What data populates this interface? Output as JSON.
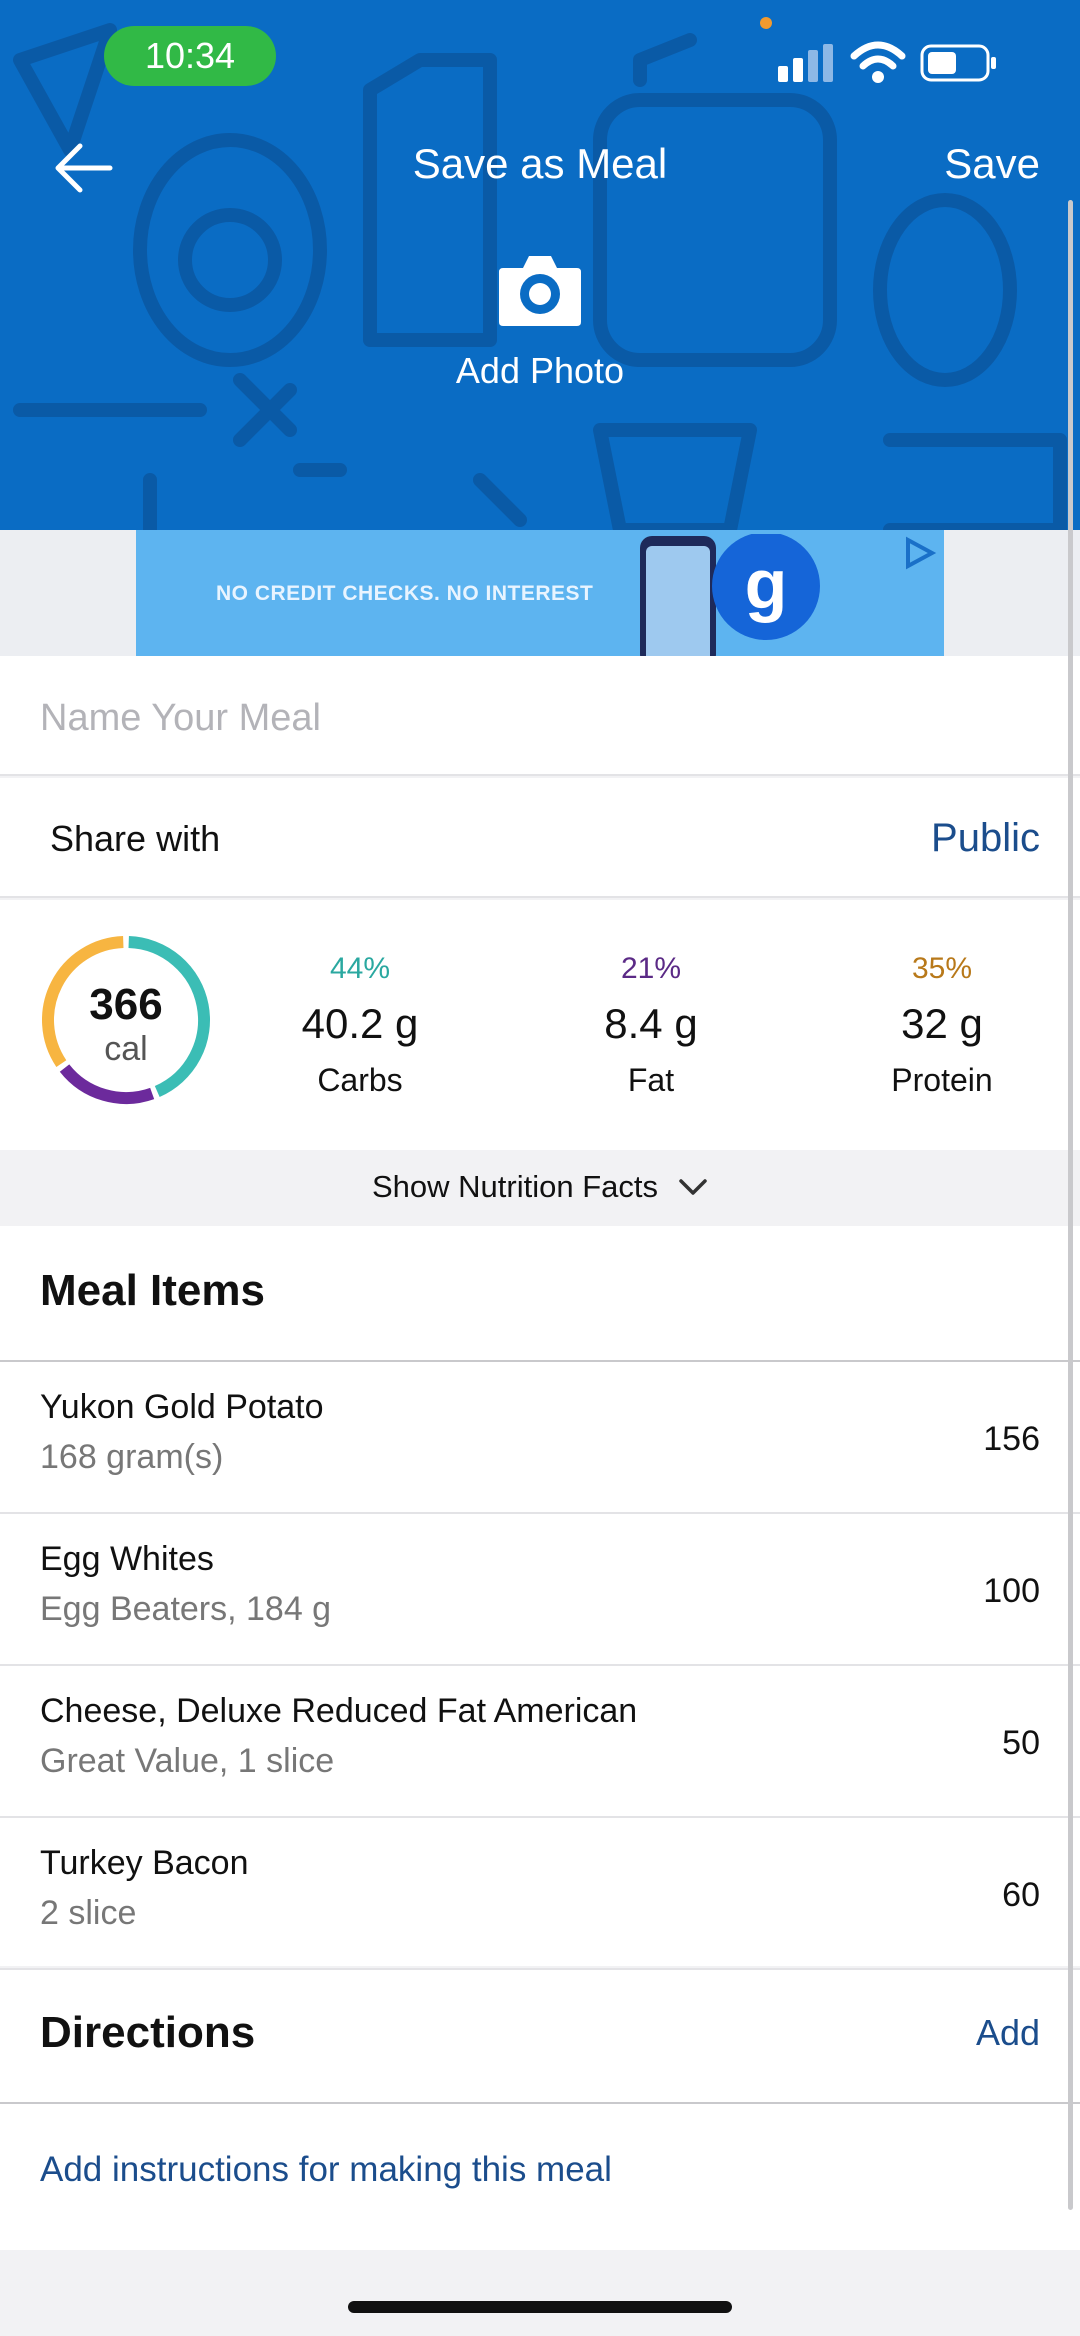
{
  "status_bar": {
    "time": "10:34"
  },
  "header": {
    "title": "Save as Meal",
    "save_label": "Save",
    "add_photo_label": "Add Photo"
  },
  "ad": {
    "text": "NO CREDIT CHECKS. NO INTEREST"
  },
  "meal_name": {
    "placeholder": "Name Your Meal",
    "value": ""
  },
  "share": {
    "label": "Share with",
    "value": "Public"
  },
  "nutrition": {
    "calories": "366",
    "calories_unit": "cal",
    "macros": [
      {
        "percent": "44%",
        "value": "40.2 g",
        "label": "Carbs",
        "color": "#2aa8a0"
      },
      {
        "percent": "21%",
        "value": "8.4 g",
        "label": "Fat",
        "color": "#5b2a86"
      },
      {
        "percent": "35%",
        "value": "32 g",
        "label": "Protein",
        "color": "#b8791a"
      }
    ],
    "ring_colors": {
      "carbs": "#3bbdb5",
      "fat": "#6c2a9c",
      "protein": "#f7b541"
    },
    "show_facts_label": "Show Nutrition Facts"
  },
  "meal_items": {
    "title": "Meal Items",
    "items": [
      {
        "name": "Yukon Gold Potato",
        "detail": "168 gram(s)",
        "calories": "156"
      },
      {
        "name": "Egg Whites",
        "detail": "Egg Beaters, 184 g",
        "calories": "100"
      },
      {
        "name": "Cheese, Deluxe Reduced Fat American",
        "detail": "Great Value, 1 slice",
        "calories": "50"
      },
      {
        "name": "Turkey Bacon",
        "detail": "2 slice",
        "calories": "60"
      }
    ]
  },
  "directions": {
    "title": "Directions",
    "add_label": "Add",
    "instructions_link": "Add instructions for making this meal"
  }
}
